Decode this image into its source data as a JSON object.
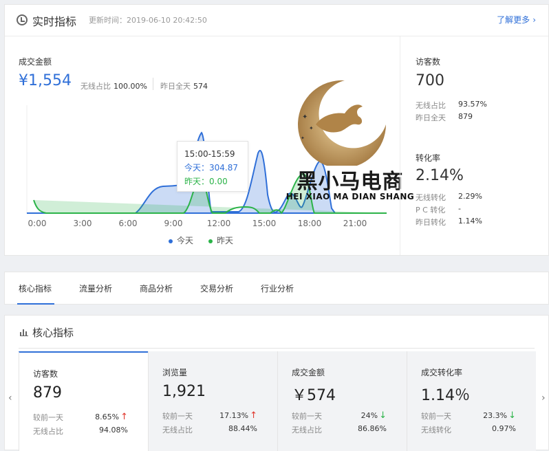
{
  "header": {
    "title": "实时指标",
    "update_label": "更新时间：",
    "update_time": "2019-06-10 20:42:50",
    "more_label": "了解更多",
    "more_chev": "›"
  },
  "sales": {
    "label": "成交金额",
    "value": "¥1,554",
    "wireless_label": "无线占比",
    "wireless_value": "100.00%",
    "yesterday_label": "昨日全天",
    "yesterday_value": "574"
  },
  "tooltip": {
    "time": "15:00-15:59",
    "today": "今天：304.87",
    "yesterday": "昨天：0.00"
  },
  "chart_data": {
    "type": "area",
    "x": [
      "0:00",
      "3:00",
      "6:00",
      "9:00",
      "12:00",
      "15:00",
      "18:00",
      "21:00"
    ],
    "series": [
      {
        "name": "今天",
        "color": "#2f6fd8"
      },
      {
        "name": "昨天",
        "color": "#2bb348"
      }
    ],
    "legend_position": "bottom"
  },
  "legend": {
    "today": "今天",
    "yesterday": "昨天"
  },
  "visitors": {
    "label": "访客数",
    "value": "700",
    "wireless_label": "无线占比",
    "wireless_value": "93.57%",
    "yesterday_label": "昨日全天",
    "yesterday_value": "879"
  },
  "conversion": {
    "label": "转化率",
    "value": "2.14%",
    "wireless_label": "无线转化",
    "wireless_value": "2.29%",
    "pc_label": "P C 转化",
    "pc_value": "-",
    "yesterday_label": "昨日转化",
    "yesterday_value": "1.14%"
  },
  "watermark": {
    "text": "黑小马电商",
    "sub": "HEI XIAO MA DIAN SHANG"
  },
  "tabs": [
    "核心指标",
    "流量分析",
    "商品分析",
    "交易分析",
    "行业分析"
  ],
  "core": {
    "title": "核心指标",
    "cards": [
      {
        "label": "访客数",
        "value": "879",
        "cmp_label": "较前一天",
        "cmp_value": "8.65%",
        "trend": "↑",
        "sub_label": "无线占比",
        "sub_value": "94.08%"
      },
      {
        "label": "浏览量",
        "value": "1,921",
        "cmp_label": "较前一天",
        "cmp_value": "17.13%",
        "trend": "↑",
        "sub_label": "无线占比",
        "sub_value": "88.44%"
      },
      {
        "label": "成交金额",
        "value": "￥574",
        "cmp_label": "较前一天",
        "cmp_value": "24%",
        "trend": "↓",
        "sub_label": "无线占比",
        "sub_value": "86.86%"
      },
      {
        "label": "成交转化率",
        "value": "1.14％",
        "cmp_label": "较前一天",
        "cmp_value": "23.3%",
        "trend": "↓",
        "sub_label": "无线转化",
        "sub_value": "0.97%"
      }
    ],
    "prev": "‹",
    "next": "›"
  }
}
